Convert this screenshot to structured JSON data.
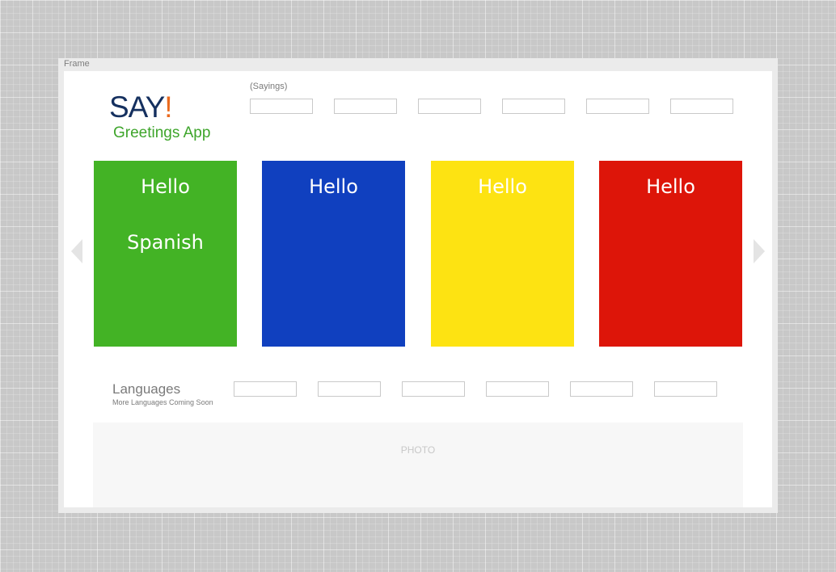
{
  "frame": {
    "label": "Frame"
  },
  "header": {
    "logo_text": "SAY",
    "logo_mark": "!",
    "app_name": "Greetings App",
    "sayings_label": "(Sayings)",
    "sayings_slots": 6
  },
  "carousel": {
    "prev_icon": "chevron-left-icon",
    "next_icon": "chevron-right-icon",
    "cards": [
      {
        "title": "Hello",
        "subtitle": "Spanish",
        "color": "#43b325"
      },
      {
        "title": "Hello",
        "subtitle": "",
        "color": "#1040bf"
      },
      {
        "title": "Hello",
        "subtitle": "",
        "color": "#fde312"
      },
      {
        "title": "Hello",
        "subtitle": "",
        "color": "#dd1509"
      }
    ]
  },
  "languages": {
    "title": "Languages",
    "subtitle": "More Languages Coming Soon",
    "slots": 6
  },
  "photo": {
    "label": "PHOTO"
  },
  "colors": {
    "logo": "#15305f",
    "logo_mark": "#ea6a1e",
    "app_name": "#3ea52b"
  }
}
